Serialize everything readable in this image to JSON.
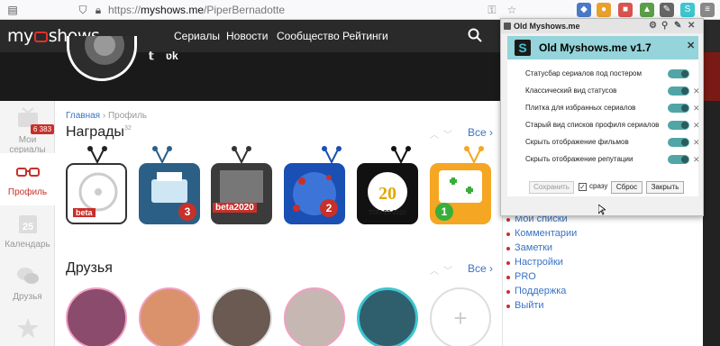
{
  "browser": {
    "url_prefix": "https://",
    "url_host": "myshows.me",
    "url_path": "/PiperBernadotte"
  },
  "site": {
    "logo_left": "my",
    "logo_right": "shows",
    "nav": [
      "Сериалы",
      "Новости",
      "Сообщество",
      "Рейтинги"
    ]
  },
  "sidebar": {
    "items": [
      {
        "label": "Мои сериалы",
        "badge": "6 383"
      },
      {
        "label": "Профиль"
      },
      {
        "label": "Календарь",
        "icon_text": "25"
      },
      {
        "label": "Друзья"
      },
      {
        "label": ""
      }
    ]
  },
  "breadcrumb": {
    "home": "Главная",
    "sep": "›",
    "current": "Профиль"
  },
  "awards": {
    "title": "Награды",
    "count": "32",
    "all_label": "Все",
    "items": [
      {
        "label": "beta",
        "color": "#ffffff"
      },
      {
        "label": "3",
        "color": "#2c5f86"
      },
      {
        "label": "beta2020",
        "color": "#3b3b3b"
      },
      {
        "label": "2",
        "color": "#1a4fb3"
      },
      {
        "label": "ТОП 20 2020",
        "color": "#111111"
      },
      {
        "label": "1",
        "color": "#f5a623"
      }
    ]
  },
  "friends": {
    "title": "Друзья",
    "all_label": "Все",
    "add_label": "+"
  },
  "right_links": [
    "Мои списки",
    "Комментарии",
    "Заметки",
    "Настройки",
    "PRO",
    "Поддержка",
    "Выйти"
  ],
  "popup": {
    "window_title": "Old Myshows.me",
    "title": "Old Myshows.me v1.7",
    "logo_letter": "S",
    "close": "✕",
    "options": [
      {
        "label": "Статусбар сериалов под постером",
        "on": true,
        "removable": false
      },
      {
        "label": "Классический вид статусов",
        "on": true,
        "removable": true
      },
      {
        "label": "Плитка для избранных сериалов",
        "on": true,
        "removable": true
      },
      {
        "label": "Старый вид списков профиля сериалов",
        "on": true,
        "removable": true
      },
      {
        "label": "Скрыть отображение фильмов",
        "on": true,
        "removable": true
      },
      {
        "label": "Скрыть отображение репутации",
        "on": true,
        "removable": true
      }
    ],
    "buttons": {
      "save": "Сохранить",
      "immediately": "сразу",
      "reset": "Сброс",
      "close": "Закрыть"
    }
  },
  "colors": {
    "brand_red": "#c8302a",
    "link_blue": "#3973c6",
    "popup_header": "#94d4da",
    "toggle": "#51a5a6"
  }
}
